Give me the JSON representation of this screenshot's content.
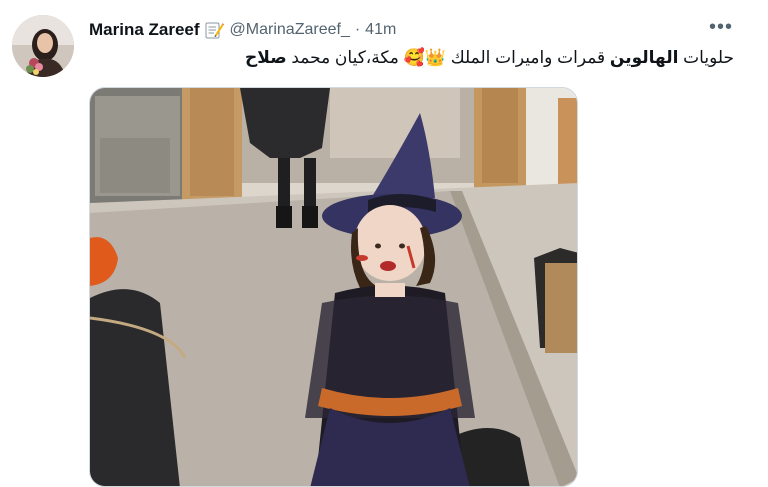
{
  "tweet": {
    "author": {
      "name": "Marina Zareef",
      "name_emoji_icon": "memo-icon",
      "handle": "@MarinaZareef_",
      "separator": "·",
      "time": "41m"
    },
    "more_icon": "more-horizontal-icon",
    "more_glyph": "•••",
    "text": {
      "part1": "حلويات ",
      "bold1": "الهالوين",
      "part2": " قمرات واميرات الملك ",
      "emoji1": "👑",
      "emoji2": "🥰",
      "part3": " مكة،كيان محمد ",
      "bold2": "صلاح"
    },
    "media": {
      "kind": "photo",
      "subject": "child in witch costume"
    }
  },
  "colors": {
    "primary_text": "#0f1419",
    "secondary_text": "#536471",
    "border": "#cfd9de"
  }
}
